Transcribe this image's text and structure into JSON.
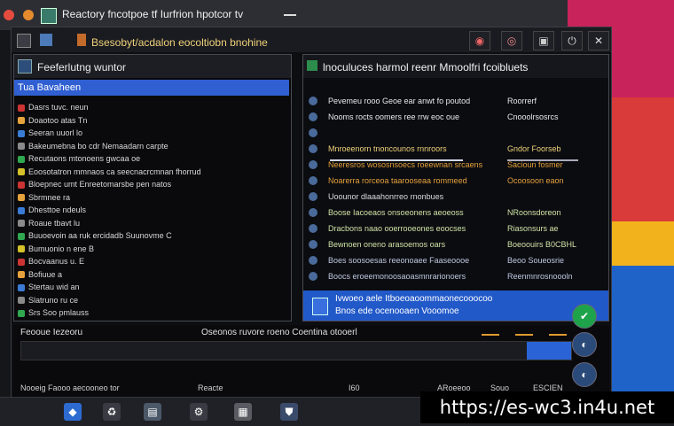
{
  "window": {
    "title": "Reactory fncotpoe tf Iurfrion hpotcor tv",
    "header": "Bsesobyt/acdalon eocoltiobn bnohine"
  },
  "left_panel": {
    "title": "Feeferlutng wuntor",
    "selected": "Tua Bavaheen",
    "rows": [
      "Dasrs tuvc. neun",
      "Doaotoo atas Tn",
      "Seeran uuorl lo",
      "Bakeumebna bo cdr Nemaadarn carpte",
      "Recutaons mtonoens gwcaa oe",
      "Eoosotatron mmnaos ca seecnacrcmnan fhorrud",
      "Bloepnec umt Enreetomarsbe pen natos",
      "Sbrmnee ra",
      "Dhesttoe ndeuls",
      "Roaue tbavt lu",
      "Buuoevoin aa ruk ercidadb Suunovme C",
      "Bumuonio n ene B",
      "Bocvaanus u. E",
      "Bofiuue a",
      "Stertau wid an",
      "Slatruno ru ce",
      "Srs Soo pmlauss"
    ]
  },
  "right_panel": {
    "title": "lnoculuces harmol reenr Mmoolfri fcoibluets",
    "rows": [
      {
        "c1": "Pevemeu  rooo  Geoe ear anwt  fo poutod",
        "c2": "Roorrerf"
      },
      {
        "c1": "Nooms  rocts oomers ree  rrw  eoc  oue",
        "c2": "Cnooolrsosrcs"
      },
      {
        "c1": "",
        "c2": ""
      },
      {
        "c1": "Mnroeenorn tnoncounos rnnroors",
        "c2": "Gndor Foorseb"
      },
      {
        "c1": "Neeresros wososnsoecs roeewnan srcaens",
        "c2": "Sacioun fosmer"
      },
      {
        "c1": "Noarerra rorceoa taarooseaa rommeed",
        "c2": "Ocoosoon eaon"
      },
      {
        "c1": "Uoounor  dlaaahonrreo rnonbues",
        "c2": ""
      },
      {
        "c1": "Boose Iacoeaos onsoeonens aeoeoss",
        "c2": "NRoonsdoreon"
      },
      {
        "c1": "Dracbons  naao ooerrooeones eoocses",
        "c2": "Riasonsurs  ae"
      },
      {
        "c1": "Bewnoen oneno arasoemos oars",
        "c2": "Boeoouirs B0CBHL"
      },
      {
        "c1": "Boes soosoesas reeonoaee Faaseoooe",
        "c2": "Beoo Soueosrie"
      },
      {
        "c1": "Boocs eroeemonoosaoasmnrarionoers",
        "c2": "Reenmnrosnoooln"
      }
    ],
    "selected_line1": "Ivwoeo aele Itboeoaoommaonecooocoo",
    "selected_line2": "Bnos ede ocenooaen Vooomoe"
  },
  "status": {
    "label": "Feooue Iezeoru",
    "message": "Oseonos ruvore roeno Coentina otooerl",
    "progress": 0.92,
    "bottom": [
      "Nooeig Faooo aecooneo tor",
      "Reacte",
      "I60",
      "ARoeeoo",
      "Souo",
      "ESCIEN"
    ]
  },
  "taskbar_icons": [
    "diamond-icon",
    "recycle-icon",
    "drive-icon",
    "settings-icon",
    "document-icon",
    "shield-icon"
  ],
  "watermark": "https://es-wc3.in4u.net",
  "colors": {
    "accent_blue": "#2f5fd1",
    "green": "#1ea34a",
    "amber": "#e09a30",
    "label_gold": "#f0d27a"
  }
}
